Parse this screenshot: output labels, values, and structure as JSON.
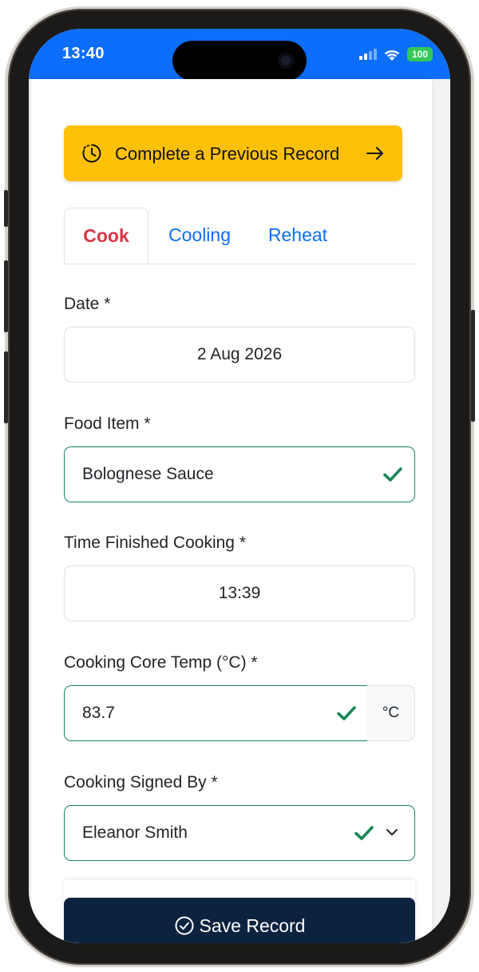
{
  "status_bar": {
    "time": "13:40",
    "battery": "100",
    "accent_color": "#0d6efd"
  },
  "banner": {
    "label": "Complete a Previous Record",
    "icon_left": "clock-history-icon",
    "icon_right": "arrow-right-icon",
    "color": "#ffc107"
  },
  "tabs": [
    {
      "label": "Cook",
      "active": true
    },
    {
      "label": "Cooling",
      "active": false
    },
    {
      "label": "Reheat",
      "active": false
    }
  ],
  "form": {
    "date": {
      "label": "Date *",
      "value": "2 Aug 2026"
    },
    "food_item": {
      "label": "Food Item *",
      "value": "Bolognese Sauce",
      "valid": true
    },
    "time_finished": {
      "label": "Time Finished Cooking *",
      "value": "13:39"
    },
    "core_temp": {
      "label": "Cooking Core Temp (°C) *",
      "value": "83.7",
      "unit": "°C",
      "valid": true
    },
    "signed_by": {
      "label": "Cooking Signed By *",
      "value": "Eleanor Smith",
      "valid": true
    }
  },
  "save_button": {
    "label": "Save Record",
    "icon": "check-circle-icon",
    "color": "#0c2340"
  },
  "colors": {
    "active_tab": "#dc3545",
    "link": "#0d6efd",
    "valid": "#198754"
  }
}
